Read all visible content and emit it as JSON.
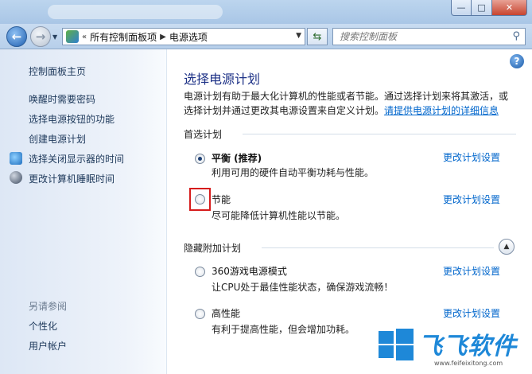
{
  "window": {
    "buttons": {
      "minimize": "—",
      "maximize": "□",
      "close": "✕"
    }
  },
  "nav": {
    "back_icon": "arrow-left-icon",
    "forward_icon": "arrow-right-icon",
    "breadcrumb": [
      "所有控制面板项",
      "电源选项"
    ],
    "search_placeholder": "搜索控制面板"
  },
  "sidebar": {
    "home": "控制面板主页",
    "links": [
      {
        "label": "唤醒时需要密码",
        "icon": null
      },
      {
        "label": "选择电源按钮的功能",
        "icon": null
      },
      {
        "label": "创建电源计划",
        "icon": null
      },
      {
        "label": "选择关闭显示器的时间",
        "icon": "monitor-icon"
      },
      {
        "label": "更改计算机睡眠时间",
        "icon": "moon-icon"
      }
    ],
    "see_also": {
      "title": "另请参阅",
      "items": [
        "个性化",
        "用户帐户"
      ]
    }
  },
  "main": {
    "title": "选择电源计划",
    "intro_text": "电源计划有助于最大化计算机的性能或者节能。通过选择计划来将其激活，或选择计划并通过更改其电源设置来自定义计划。",
    "intro_link": "请提供电源计划的详细信息",
    "preferred": {
      "header": "首选计划",
      "plans": [
        {
          "name": "平衡 (推荐)",
          "desc": "利用可用的硬件自动平衡功耗与性能。",
          "selected": true,
          "settings": "更改计划设置"
        },
        {
          "name": "节能",
          "desc": "尽可能降低计算机性能以节能。",
          "selected": false,
          "settings": "更改计划设置"
        }
      ]
    },
    "hidden": {
      "header": "隐藏附加计划",
      "plans": [
        {
          "name": "360游戏电源模式",
          "desc": "让CPU处于最佳性能状态，确保游戏流畅！",
          "selected": false,
          "settings": "更改计划设置"
        },
        {
          "name": "高性能",
          "desc": "有利于提高性能，但会增加功耗。",
          "selected": false,
          "settings": "更改计划设置"
        }
      ]
    }
  },
  "watermark": {
    "brand": "飞飞软件",
    "url": "www.feifeixitong.com"
  },
  "colors": {
    "link": "#0066cc",
    "title": "#1e3287",
    "highlight": "#d61c1c",
    "watermark": "#1e88d8"
  }
}
